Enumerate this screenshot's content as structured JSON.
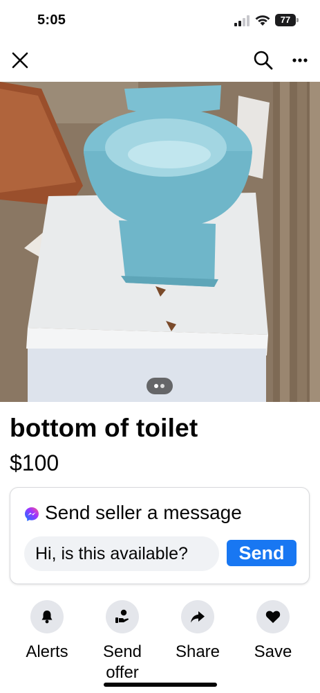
{
  "status_bar": {
    "time": "5:05",
    "battery": "77"
  },
  "nav": {
    "close_icon": "close-icon",
    "search_icon": "search-icon",
    "more_icon": "more-icon"
  },
  "photo": {
    "description_icon": "photo",
    "page_indicator_count": 2,
    "current_page": 1
  },
  "listing": {
    "title": "bottom of toilet",
    "price": "$100"
  },
  "message_card": {
    "title": "Send seller a message",
    "input_value": "Hi, is this available?",
    "send_label": "Send"
  },
  "actions": [
    {
      "label": "Alerts",
      "icon": "bell-icon"
    },
    {
      "label": "Send offer",
      "icon": "offer-icon"
    },
    {
      "label": "Share",
      "icon": "share-icon"
    },
    {
      "label": "Save",
      "icon": "heart-icon"
    }
  ],
  "colors": {
    "accent": "#1877f2",
    "circle_bg": "#e4e6eb",
    "input_bg": "#f0f2f5"
  }
}
